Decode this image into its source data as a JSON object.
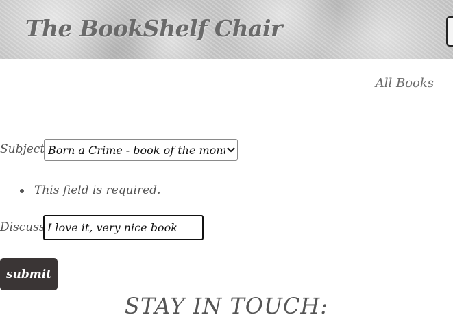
{
  "header": {
    "title": "The BookShelf Chair"
  },
  "nav": {
    "all_books": "All Books"
  },
  "form": {
    "subject_label": "Subject:",
    "subject_selected": "Born a Crime - book of the month!",
    "errors": [
      "This field is required."
    ],
    "discuss_label": "Discuss:",
    "discuss_value": "I love it, very nice book",
    "submit_label": "submit"
  },
  "footer": {
    "heading": "STAY IN TOUCH:"
  },
  "icons": {
    "select_arrow": "chevron-down-icon"
  }
}
